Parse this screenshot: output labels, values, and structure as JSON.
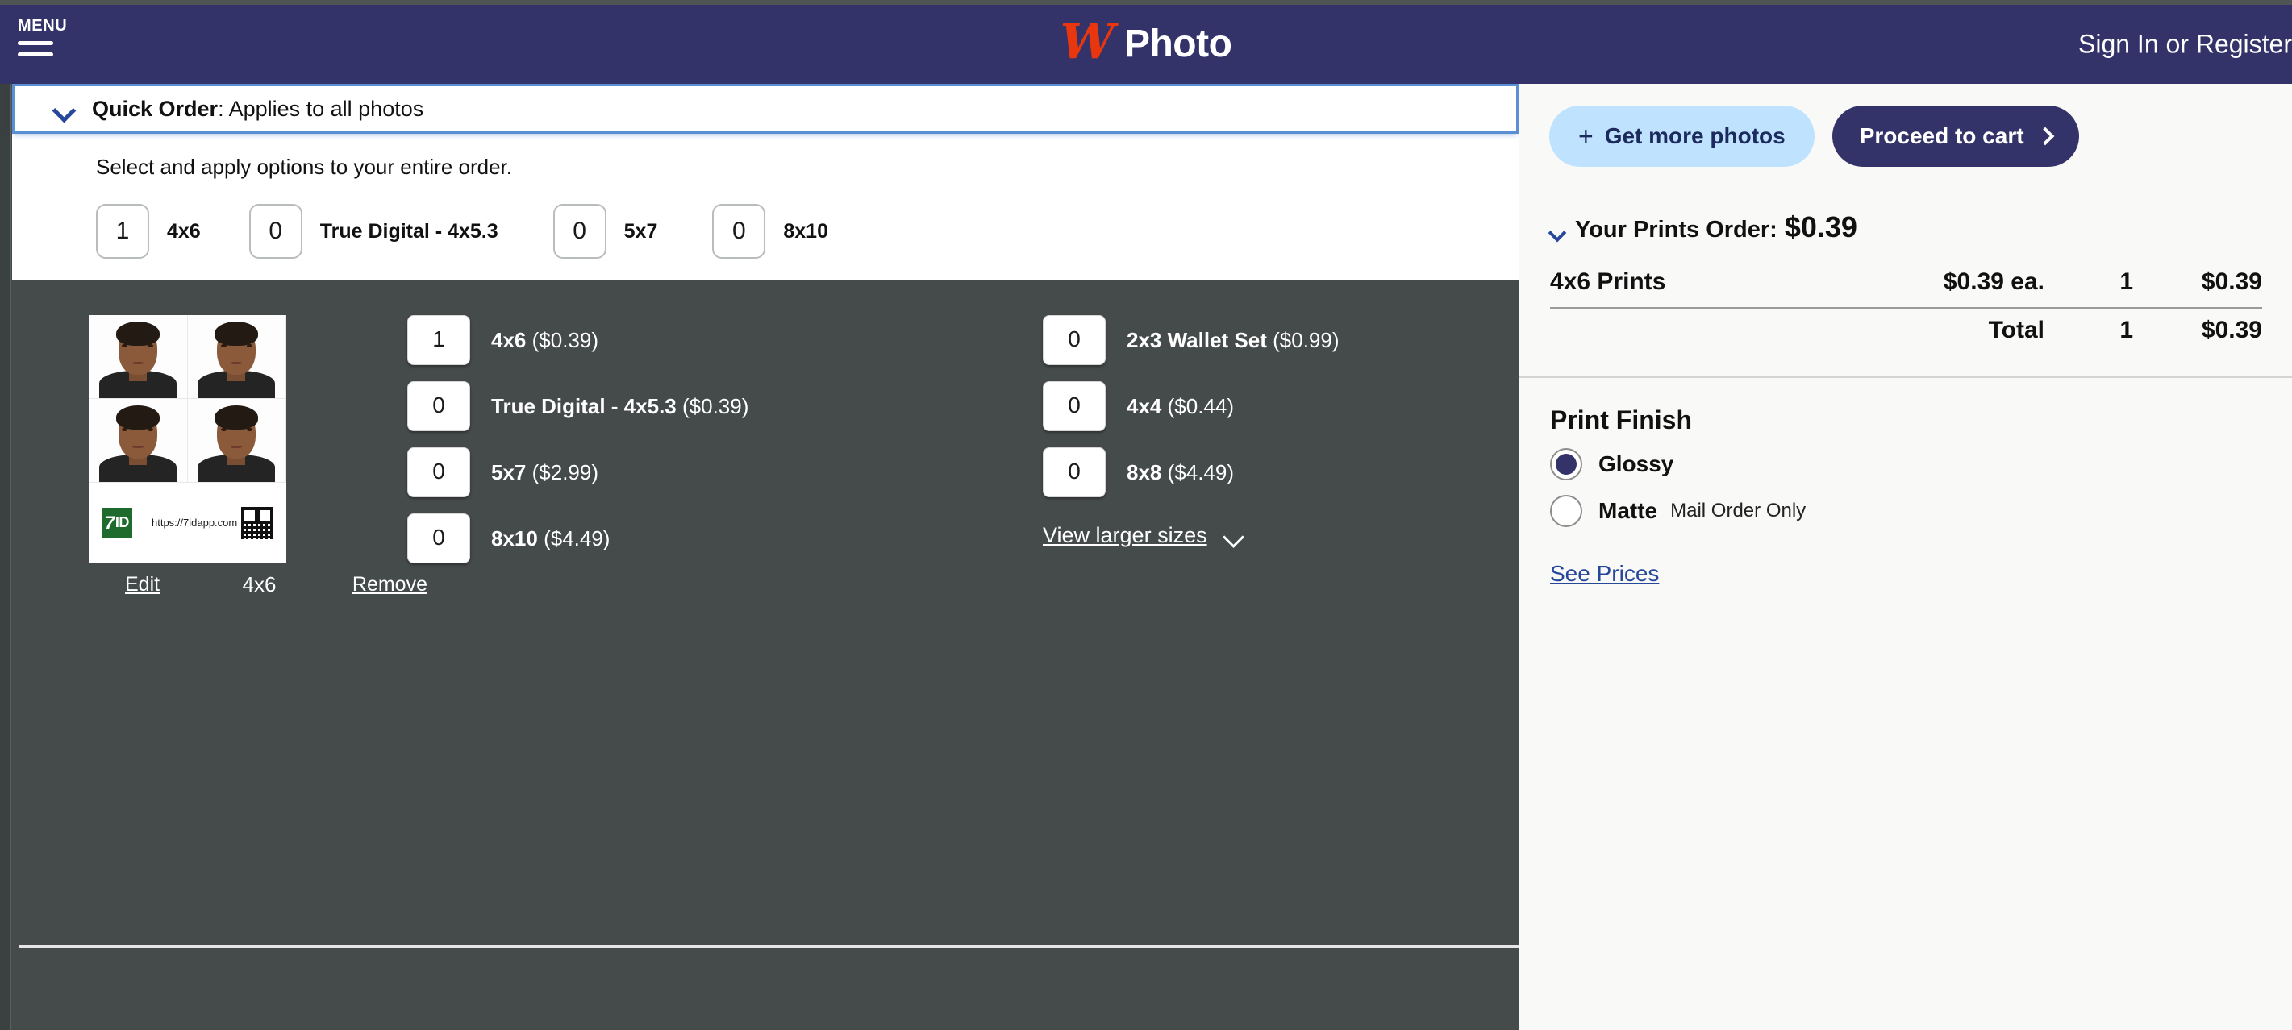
{
  "header": {
    "menu_label": "MENU",
    "brand_mark": "W",
    "brand_name": "Photo",
    "signin_label": "Sign In or Register",
    "bg_color": "#33336a",
    "brand_color": "#e8360f"
  },
  "quick_order": {
    "title_bold": "Quick Order",
    "title_rest": ": Applies to all photos",
    "subtitle": "Select and apply options to your entire order.",
    "sizes": [
      {
        "qty": "1",
        "label": "4x6"
      },
      {
        "qty": "0",
        "label": "True Digital - 4x5.3"
      },
      {
        "qty": "0",
        "label": "5x7"
      },
      {
        "qty": "0",
        "label": "8x10"
      }
    ]
  },
  "item": {
    "size_caption": "4x6",
    "edit_label": "Edit",
    "remove_label": "Remove",
    "watermark_url": "https://7idapp.com",
    "watermark_logo_seven": "7",
    "watermark_logo_id": "ID",
    "options_col1": [
      {
        "qty": "1",
        "name": "4x6",
        "price": "($0.39)"
      },
      {
        "qty": "0",
        "name": "True Digital - 4x5.3",
        "price": "($0.39)"
      },
      {
        "qty": "0",
        "name": "5x7",
        "price": "($2.99)"
      },
      {
        "qty": "0",
        "name": "8x10",
        "price": "($4.49)"
      }
    ],
    "options_col2": [
      {
        "qty": "0",
        "name": "2x3 Wallet Set",
        "price": "($0.99)"
      },
      {
        "qty": "0",
        "name": "4x4",
        "price": "($0.44)"
      },
      {
        "qty": "0",
        "name": "8x8",
        "price": "($4.49)"
      }
    ],
    "view_larger_label": "View larger sizes"
  },
  "sidebar": {
    "get_more_photos": "Get more photos",
    "get_more_plus": "+",
    "proceed_to_cart": "Proceed to cart",
    "order_label": "Your Prints Order:",
    "order_amount": "$0.39",
    "lines": [
      {
        "name": "4x6 Prints",
        "each": "$0.39 ea.",
        "qty": "1",
        "total": "$0.39"
      }
    ],
    "total_label": "Total",
    "total_qty": "1",
    "total_amount": "$0.39",
    "finish_title": "Print Finish",
    "finish_options": [
      {
        "label": "Glossy",
        "note": "",
        "selected": true
      },
      {
        "label": "Matte",
        "note": "Mail Order Only",
        "selected": false
      }
    ],
    "see_prices": "See Prices",
    "accent_color": "#33336a",
    "link_color": "#27479a"
  }
}
